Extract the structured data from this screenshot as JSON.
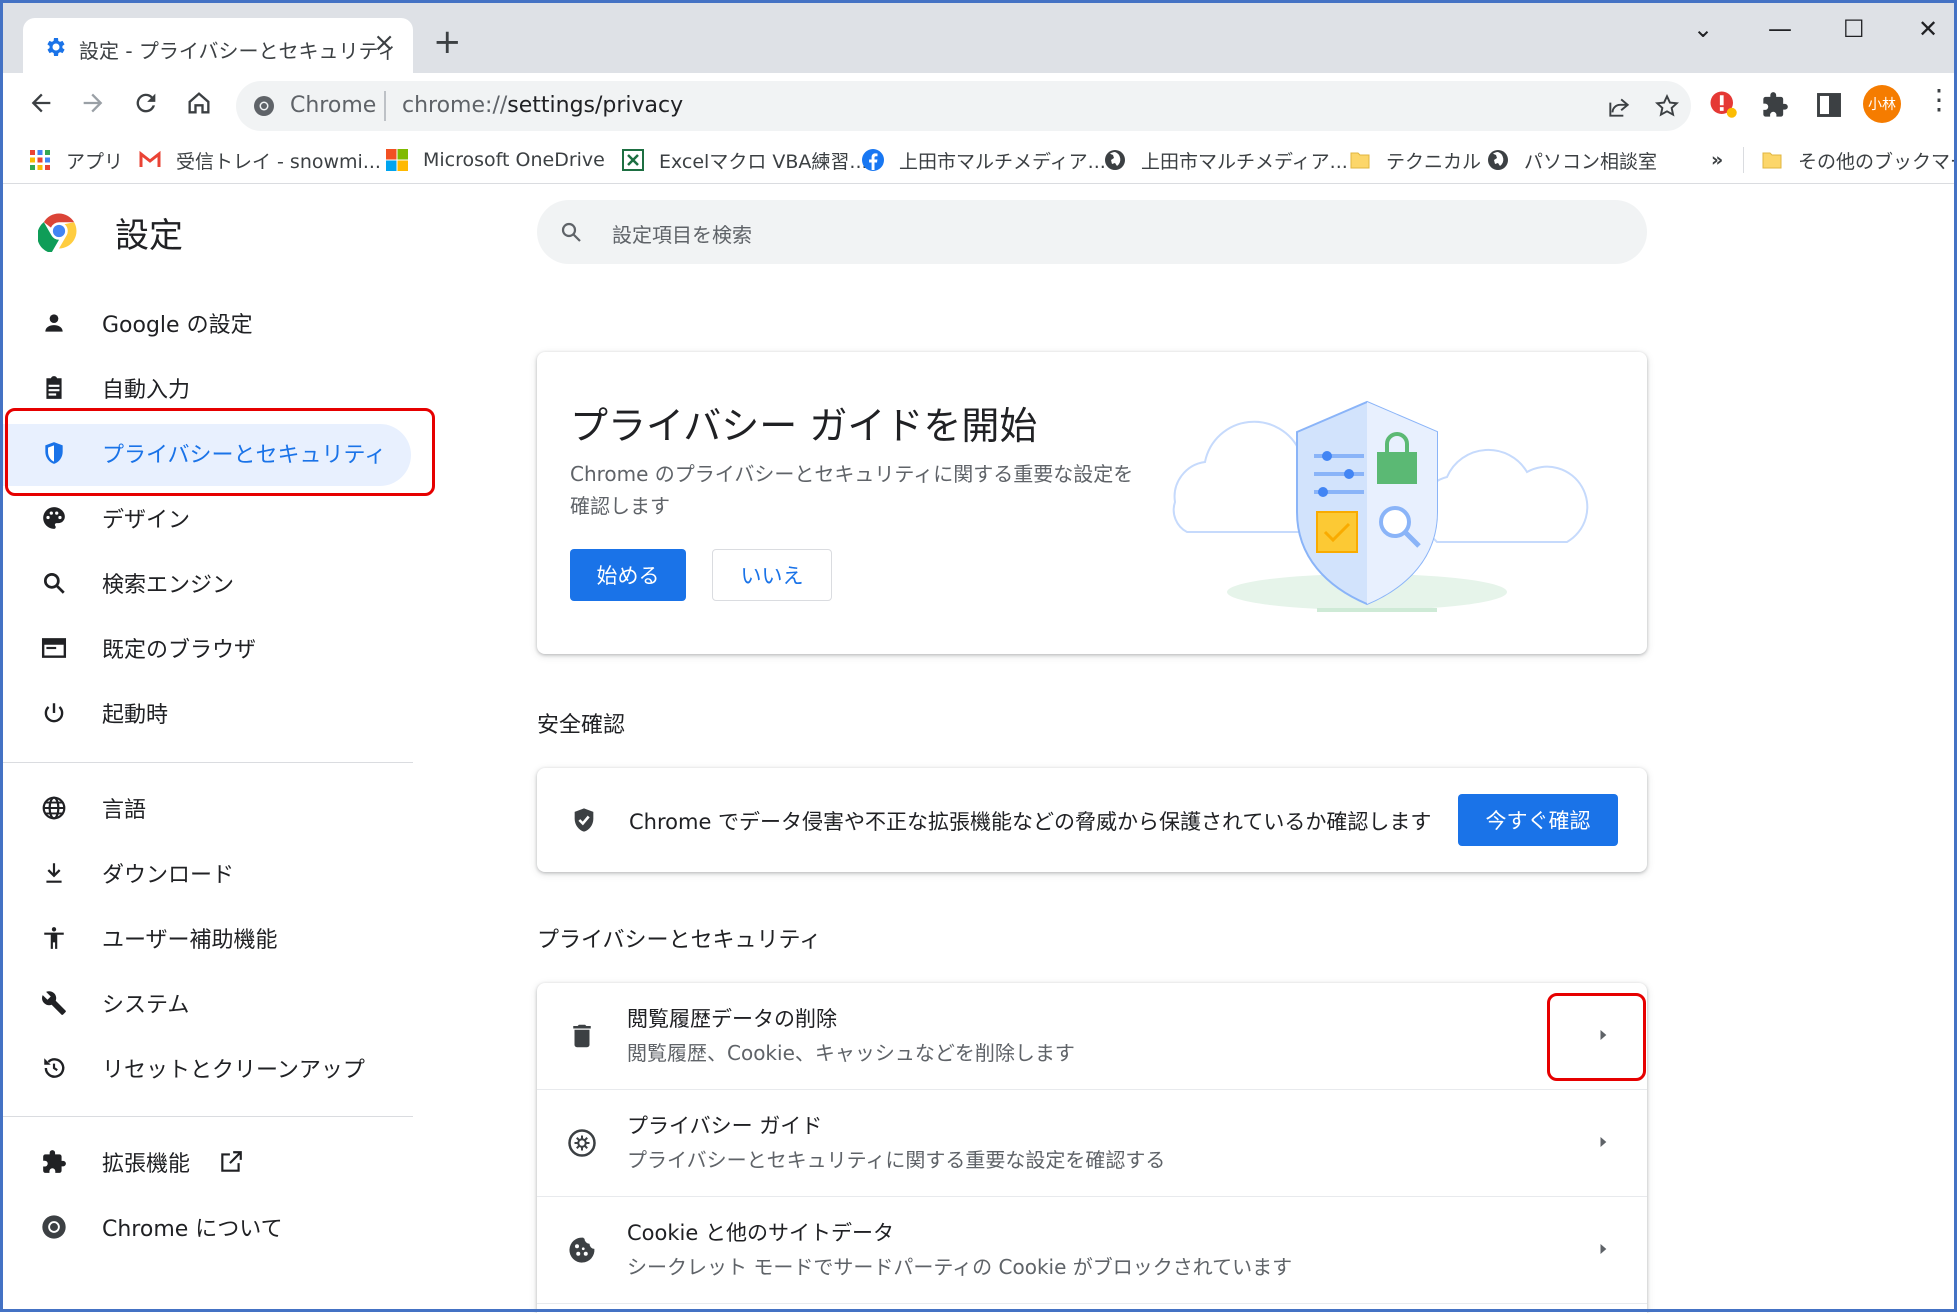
{
  "tab": {
    "title": "設定 - プライバシーとセキュリティ",
    "close": "×",
    "new_tab": "+"
  },
  "window_controls": {
    "dropdown": "⌄",
    "minimize": "—",
    "maximize": "☐",
    "close": "✕"
  },
  "omnibox": {
    "site": "Chrome",
    "url_scheme": "chrome://",
    "url_path": "settings/privacy"
  },
  "profile_avatar_text": "小林",
  "bookmarks": [
    {
      "label": "アプリ",
      "icon": "apps-grid-icon"
    },
    {
      "label": "受信トレイ - snowmi...",
      "icon": "gmail-icon"
    },
    {
      "label": "Microsoft OneDrive",
      "icon": "microsoft-icon"
    },
    {
      "label": "Excelマクロ VBA練習...",
      "icon": "excel-icon"
    },
    {
      "label": "上田市マルチメディア...",
      "icon": "facebook-icon"
    },
    {
      "label": "上田市マルチメディア...",
      "icon": "globe-icon"
    },
    {
      "label": "テクニカル",
      "icon": "folder-icon"
    },
    {
      "label": "パソコン相談室",
      "icon": "globe-icon"
    },
    {
      "label": "»",
      "icon": ""
    },
    {
      "label": "その他のブックマーク",
      "icon": "folder-icon"
    }
  ],
  "sidebar": {
    "title": "設定",
    "items": [
      {
        "label": "Google の設定",
        "icon": "person-icon"
      },
      {
        "label": "自動入力",
        "icon": "clipboard-icon"
      },
      {
        "label": "プライバシーとセキュリティ",
        "icon": "shield-icon"
      },
      {
        "label": "デザイン",
        "icon": "palette-icon"
      },
      {
        "label": "検索エンジン",
        "icon": "search-icon"
      },
      {
        "label": "既定のブラウザ",
        "icon": "browser-icon"
      },
      {
        "label": "起動時",
        "icon": "power-icon"
      },
      {
        "label": "言語",
        "icon": "globe-icon"
      },
      {
        "label": "ダウンロード",
        "icon": "download-icon"
      },
      {
        "label": "ユーザー補助機能",
        "icon": "accessibility-icon"
      },
      {
        "label": "システム",
        "icon": "wrench-icon"
      },
      {
        "label": "リセットとクリーンアップ",
        "icon": "reset-icon"
      },
      {
        "label": "拡張機能",
        "icon": "puzzle-icon"
      },
      {
        "label": "Chrome について",
        "icon": "chrome-icon"
      }
    ]
  },
  "search": {
    "placeholder": "設定項目を検索"
  },
  "privacy_guide": {
    "title": "プライバシー ガイドを開始",
    "description": "Chrome のプライバシーとセキュリティに関する重要な設定を確認します",
    "start_label": "始める",
    "no_label": "いいえ"
  },
  "safety_check": {
    "heading": "安全確認",
    "text": "Chrome でデータ侵害や不正な拡張機能などの脅威から保護されているか確認します",
    "button_label": "今すぐ確認"
  },
  "privacy_section": {
    "heading": "プライバシーとセキュリティ",
    "rows": [
      {
        "title": "閲覧履歴データの削除",
        "subtitle": "閲覧履歴、Cookie、キャッシュなどを削除します",
        "icon": "trash-icon"
      },
      {
        "title": "プライバシー ガイド",
        "subtitle": "プライバシーとセキュリティに関する重要な設定を確認する",
        "icon": "compass-icon"
      },
      {
        "title": "Cookie と他のサイトデータ",
        "subtitle": "シークレット モードでサードパーティの Cookie がブロックされています",
        "icon": "cookie-icon"
      }
    ]
  },
  "colors": {
    "accent": "#1a73e8",
    "highlight": "#e60000",
    "active_bg": "#e8f0fe"
  }
}
